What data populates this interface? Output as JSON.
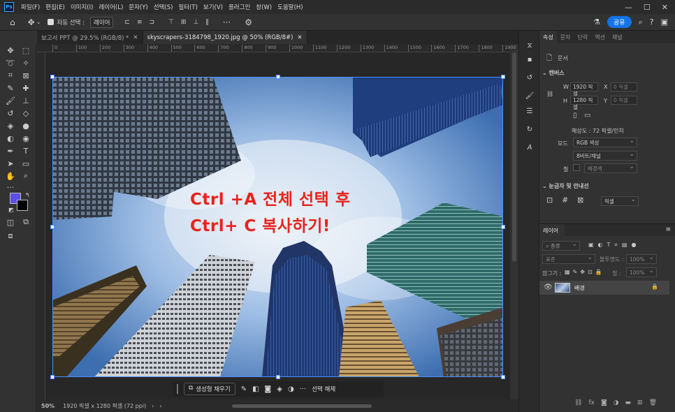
{
  "menu": {
    "logo": "Ps",
    "items": [
      "파일(F)",
      "편집(E)",
      "이미지(I)",
      "레이어(L)",
      "문자(Y)",
      "선택(S)",
      "필터(T)",
      "보기(V)",
      "플러그인",
      "창(W)",
      "도움말(H)"
    ]
  },
  "options": {
    "autoselect_label": "자동 선택 :",
    "autoselect_value": "레이어",
    "share_label": "공유"
  },
  "tabs": [
    {
      "label": "보고서 PPT @ 29.5% (RGB/8) *"
    },
    {
      "label": "skyscrapers-3184798_1920.jpg @ 50% (RGB/8#)"
    }
  ],
  "ruler_ticks": [
    "0",
    "100",
    "200",
    "300",
    "400",
    "500",
    "600",
    "700",
    "800",
    "900",
    "1000",
    "1100",
    "1200",
    "1300",
    "1400",
    "1500",
    "1600",
    "1700",
    "1800",
    "1900"
  ],
  "overlay": {
    "line1": "Ctrl +A 전체 선택 후",
    "line2": "Ctrl+ C 복사하기!",
    "color": "#e8231c"
  },
  "status": {
    "zoom": "50%",
    "doc_size": "1920 픽셀 x 1280 픽셀 (72 ppi)"
  },
  "context_bar": {
    "generative_fill": "생성형 채우기",
    "deselect": "선택 해제"
  },
  "properties": {
    "tabs": [
      "속성",
      "문자",
      "단락",
      "액션",
      "채널"
    ],
    "doc_label": "문서",
    "canvas_header": "캔버스",
    "w_label": "W",
    "w_value": "1920 픽셀",
    "x_label": "X",
    "x_placeholder": "0 픽셀",
    "h_label": "H",
    "h_value": "1280 픽셀",
    "y_label": "Y",
    "y_placeholder": "0 픽셀",
    "resolution": "해상도 : 72 픽셀/인치",
    "mode_label": "모드",
    "mode_value": "RGB 색상",
    "depth_value": "8비트/채널",
    "fill_label": "칠",
    "fill_value": "배경색",
    "rulers_header": "눈금자 및 안내선",
    "unit_value": "픽셀"
  },
  "layers": {
    "tab": "레이어",
    "filter_label": "종류",
    "blend_mode": "표준",
    "opacity_label": "불투명도 :",
    "opacity_value": "100%",
    "lock_label": "잠그기 :",
    "fill_label": "칠 :",
    "fill_value": "100%",
    "items": [
      {
        "name": "배경"
      }
    ]
  },
  "colors": {
    "foreground": "#5b4fe8",
    "background": "#000000",
    "accent": "#1473e6"
  }
}
